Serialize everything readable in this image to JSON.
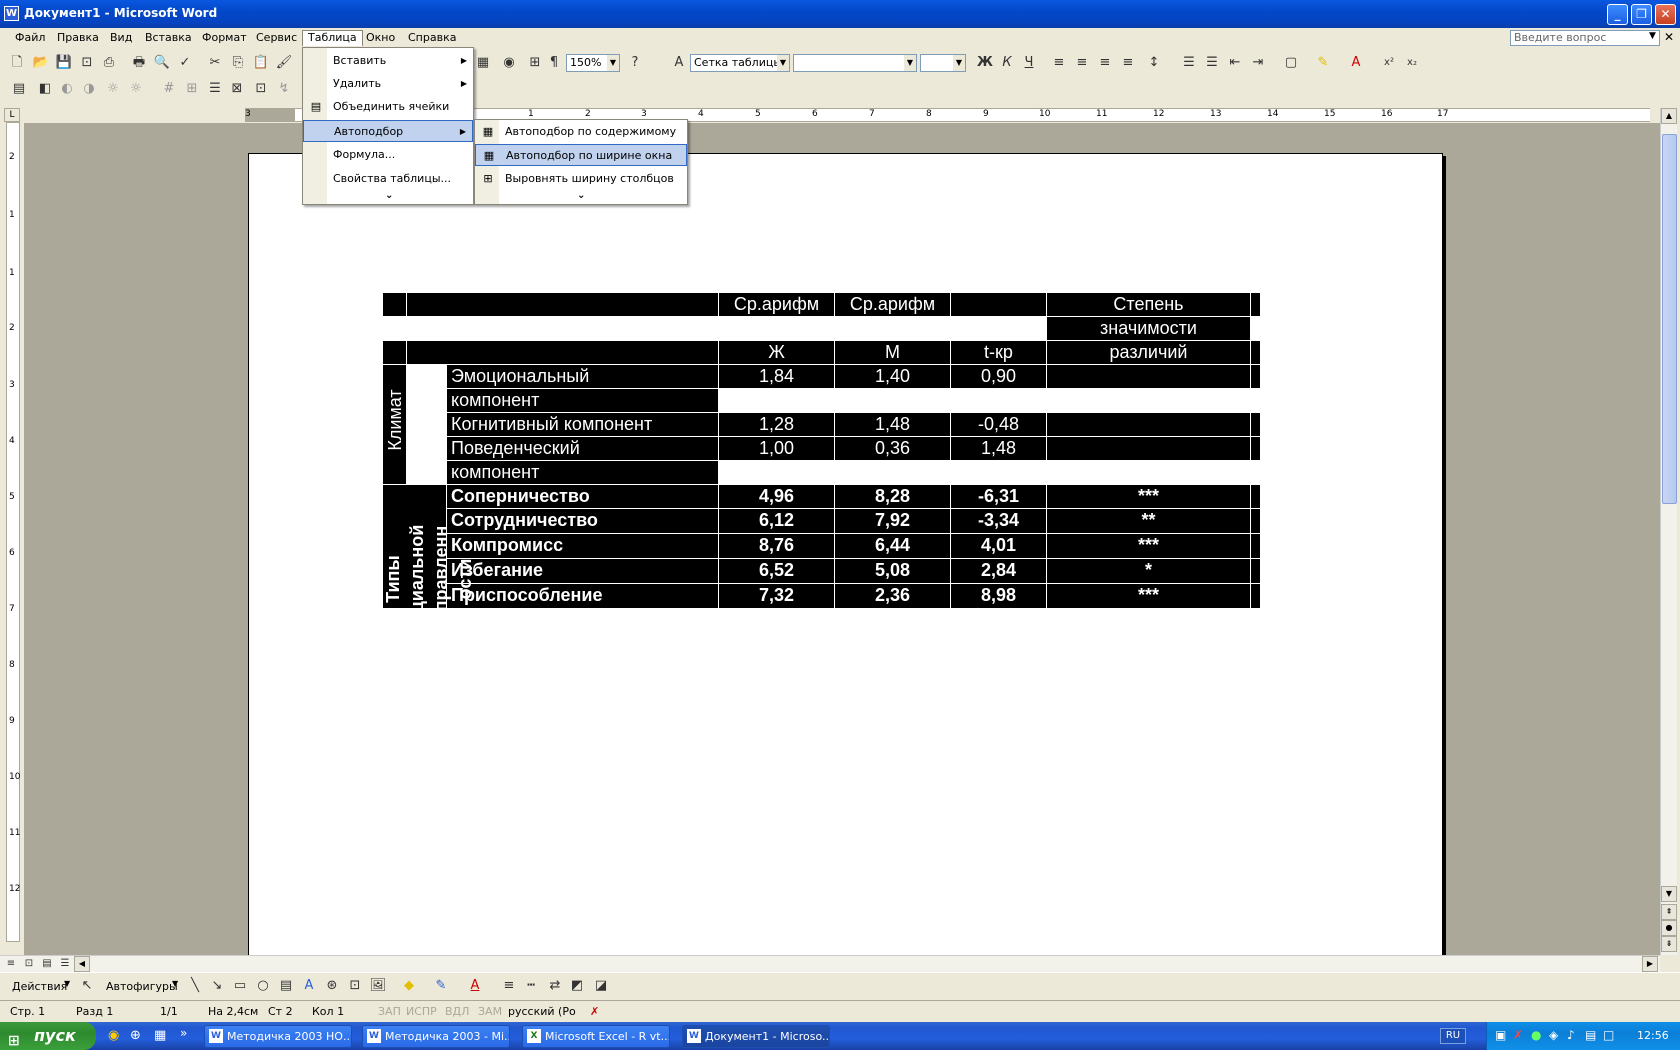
{
  "window": {
    "title": "Документ1 - Microsoft Word",
    "icon": "word-icon"
  },
  "menubar": {
    "items": [
      "Файл",
      "Правка",
      "Вид",
      "Вставка",
      "Формат",
      "Сервис",
      "Таблица",
      "Окно",
      "Справка"
    ],
    "active": "Таблица",
    "ask_placeholder": "Введите вопрос"
  },
  "toolbar": {
    "zoom": "150%",
    "style": "Сетка таблицы",
    "font": "",
    "size": ""
  },
  "table_menu": {
    "items": [
      {
        "label": "Вставить",
        "submenu": true
      },
      {
        "label": "Удалить",
        "submenu": true
      },
      {
        "label": "Объединить ячейки",
        "submenu": false
      },
      {
        "label": "Автоподбор",
        "submenu": true
      },
      {
        "label": "Формула...",
        "submenu": false
      },
      {
        "label": "Свойства таблицы...",
        "submenu": false
      }
    ]
  },
  "autofit_menu": {
    "items": [
      {
        "label": "Автоподбор по содержимому"
      },
      {
        "label": "Автоподбор по ширине окна"
      },
      {
        "label": "Выровнять ширину столбцов"
      }
    ]
  },
  "ruler": {
    "h_numbers": [
      "3",
      "1",
      "2",
      "3",
      "4",
      "5",
      "6",
      "7",
      "8",
      "9",
      "10",
      "11",
      "12",
      "13",
      "14",
      "15",
      "16",
      "17"
    ],
    "v_numbers": [
      "2",
      "1",
      "1",
      "2",
      "3",
      "4",
      "5",
      "6",
      "7",
      "8",
      "9",
      "10",
      "11",
      "12"
    ]
  },
  "table": {
    "header": {
      "col3a": "Ср.арифм",
      "col4a": "Ср.арифм",
      "col6a": "Степень",
      "col6b": "значимости",
      "col3b": "Ж",
      "col4b": "М",
      "col5b": "t-кр",
      "col6c": "различий"
    },
    "group1": {
      "label": "Климат",
      "rows": [
        {
          "name": "Эмоциональный компонент",
          "f": "1,84",
          "m": "1,40",
          "t": "0,90",
          "sig": ""
        },
        {
          "name": "Когнитивный компонент",
          "f": "1,28",
          "m": "1,48",
          "t": "-0,48",
          "sig": ""
        },
        {
          "name": "Поведенческий компонент",
          "f": "1,00",
          "m": "0,36",
          "t": "1,48",
          "sig": ""
        }
      ]
    },
    "group2": {
      "label": "Типы социальной направленности",
      "label_lines": [
        "Типы",
        "социальной",
        "направленн",
        "ости"
      ],
      "rows": [
        {
          "name": "Соперничество",
          "f": "4,96",
          "m": "8,28",
          "t": "-6,31",
          "sig": "***"
        },
        {
          "name": "Сотрудничество",
          "f": "6,12",
          "m": "7,92",
          "t": "-3,34",
          "sig": "**"
        },
        {
          "name": "Компромисс",
          "f": "8,76",
          "m": "6,44",
          "t": "4,01",
          "sig": "***"
        },
        {
          "name": "Избегание",
          "f": "6,52",
          "m": "5,08",
          "t": "2,84",
          "sig": "*"
        },
        {
          "name": "Приспособление",
          "f": "7,32",
          "m": "2,36",
          "t": "8,98",
          "sig": "***"
        }
      ]
    }
  },
  "drawbar": {
    "actions": "Действия",
    "autoshapes": "Автофигуры"
  },
  "status": {
    "page": "Стр. 1",
    "section": "Разд 1",
    "pages": "1/1",
    "at": "На 2,4см",
    "line": "Ст 2",
    "col": "Кол 1",
    "rec": "ЗАП",
    "trk": "ИСПР",
    "ext": "ВДЛ",
    "ovr": "ЗАМ",
    "lang": "русский (Ро"
  },
  "taskbar": {
    "start": "пуск",
    "items": [
      "Методичка 2003 НО...",
      "Методичка 2003 - Mi...",
      "Microsoft Excel - R vt...",
      "Документ1 - Microso..."
    ],
    "lang": "RU",
    "clock": "12:56"
  }
}
